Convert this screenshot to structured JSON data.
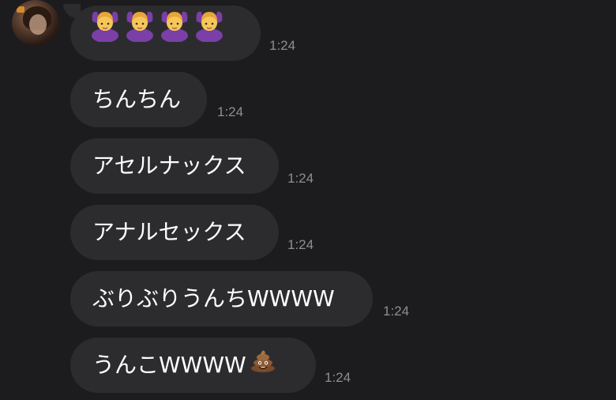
{
  "messages": [
    {
      "text": "",
      "time": "1:24",
      "emoji": [
        "woman-gesturing-ok",
        "woman-gesturing-ok",
        "woman-gesturing-ok",
        "woman-gesturing-ok"
      ]
    },
    {
      "text": "ちんちん",
      "time": "1:24"
    },
    {
      "text": "アセルナックス",
      "time": "1:24"
    },
    {
      "text": "アナルセックス",
      "time": "1:24"
    },
    {
      "text": "ぶりぶりうんちWWWW",
      "time": "1:24"
    },
    {
      "text": "うんこWWWW",
      "time": "1:24",
      "emoji": [
        "pile-of-poo"
      ]
    }
  ],
  "colors": {
    "background": "#1c1c1e",
    "bubble": "#2c2c2e",
    "text": "#ffffff",
    "timestamp": "#8e8e93",
    "emoji_purple": "#7b3fa8",
    "emoji_skin": "#f5c75a"
  }
}
